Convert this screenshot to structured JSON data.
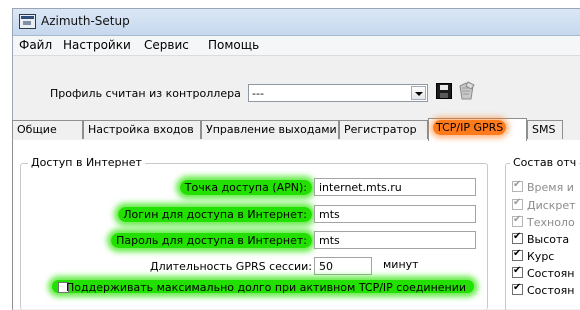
{
  "window": {
    "title": "Azimuth-Setup"
  },
  "menu": [
    "Файл",
    "Настройки",
    "Сервис",
    "Помощь"
  ],
  "profile": {
    "label": "Профиль считан из контроллера",
    "value": "---"
  },
  "tabs": [
    {
      "label": "Общие"
    },
    {
      "label": "Настройка входов"
    },
    {
      "label": "Управление выходами"
    },
    {
      "label": "Регистратор"
    },
    {
      "label": "TCP/IP GPRS"
    },
    {
      "label": "SMS"
    }
  ],
  "internet": {
    "legend": "Доступ в Интернет",
    "apn_label": "Точка доступа (APN):",
    "apn_value": "internet.mts.ru",
    "login_label": "Логин для доступа в Интернет:",
    "login_value": "mts",
    "password_label": "Пароль для доступа в Интернет:",
    "password_value": "mts",
    "session_label": "Длительность GPRS сессии:",
    "session_value": "50",
    "session_units": "минут",
    "keep_alive_label": "Поддерживать максимально долго при активном TCP/IP соединении",
    "keep_alive_checked": false
  },
  "report": {
    "legend": "Состав отч",
    "items": [
      {
        "label": "Время и",
        "checked": true,
        "disabled": true
      },
      {
        "label": "Дискрет",
        "checked": true,
        "disabled": true
      },
      {
        "label": "Техноло",
        "checked": true,
        "disabled": true
      },
      {
        "label": "Высота",
        "checked": true,
        "disabled": false
      },
      {
        "label": "Курс",
        "checked": true,
        "disabled": false
      },
      {
        "label": "Состоян",
        "checked": true,
        "disabled": false
      },
      {
        "label": "Состоян",
        "checked": true,
        "disabled": false
      }
    ]
  },
  "colors": {
    "tab_highlight": "#ff7a1a",
    "field_highlight": "#22e000"
  }
}
